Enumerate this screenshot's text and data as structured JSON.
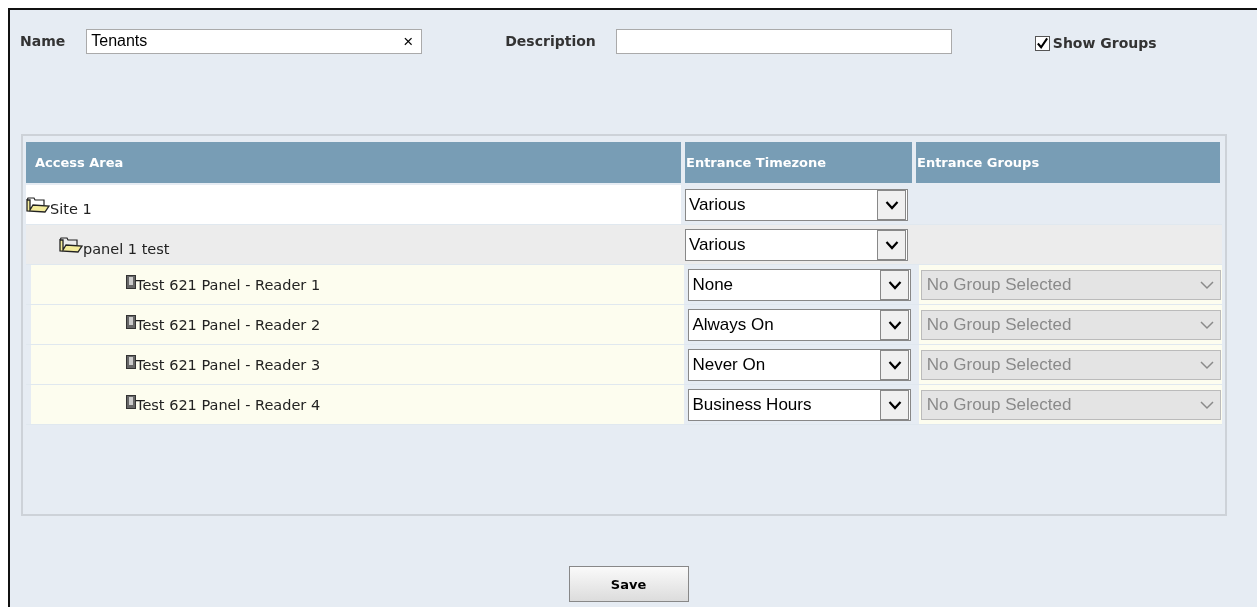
{
  "form": {
    "name_label": "Name",
    "name_value": "Tenants",
    "clear_icon": "×",
    "description_label": "Description",
    "show_groups": {
      "label": "Show Groups",
      "checked": true
    }
  },
  "table": {
    "columns": [
      "Access Area",
      "Entrance Timezone",
      "Entrance Groups"
    ],
    "rows": [
      {
        "kind": "folder",
        "label": "Site 1",
        "timezone": "Various",
        "children": [
          {
            "kind": "folder",
            "label": "panel 1 test",
            "timezone": "Various",
            "children": [
              {
                "kind": "reader",
                "label": "Test 621 Panel - Reader 1",
                "timezone": "None",
                "group": "No Group Selected",
                "group_disabled": true
              },
              {
                "kind": "reader",
                "label": "Test 621 Panel - Reader 2",
                "timezone": "Always On",
                "group": "No Group Selected",
                "group_disabled": true
              },
              {
                "kind": "reader",
                "label": "Test 621 Panel - Reader 3",
                "timezone": "Never On",
                "group": "No Group Selected",
                "group_disabled": true
              },
              {
                "kind": "reader",
                "label": "Test 621 Panel - Reader 4",
                "timezone": "Business Hours",
                "group": "No Group Selected",
                "group_disabled": true
              }
            ]
          }
        ]
      }
    ]
  },
  "buttons": [
    {
      "label": "Save"
    }
  ]
}
